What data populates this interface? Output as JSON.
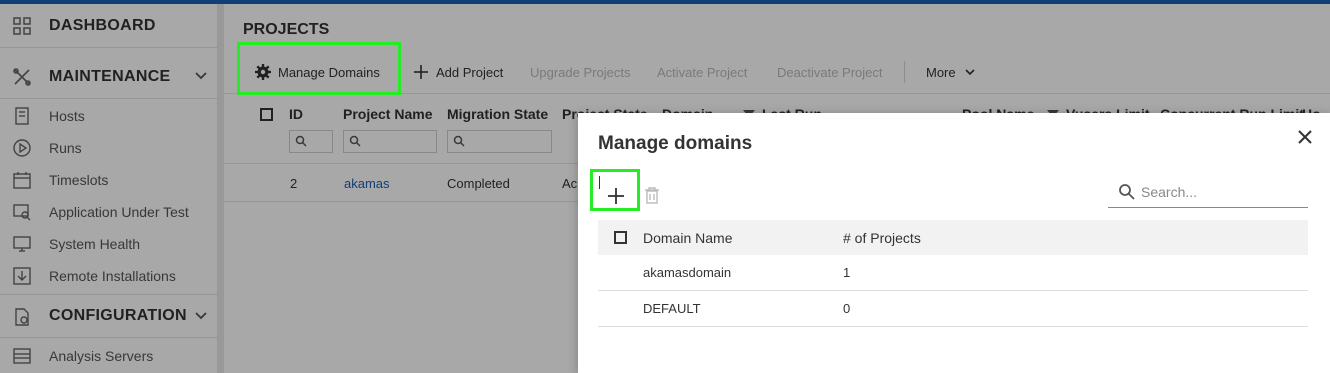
{
  "sidebar": {
    "dashboard": {
      "label": "DASHBOARD",
      "icon": "dashboard-grid-icon"
    },
    "maintenance": {
      "label": "MAINTENANCE",
      "icon": "tools-icon",
      "items": [
        {
          "label": "Hosts",
          "icon": "hosts-icon"
        },
        {
          "label": "Runs",
          "icon": "play-circle-icon"
        },
        {
          "label": "Timeslots",
          "icon": "calendar-icon"
        },
        {
          "label": "Application Under Test",
          "icon": "app-search-icon"
        },
        {
          "label": "System Health",
          "icon": "monitor-icon"
        },
        {
          "label": "Remote Installations",
          "icon": "download-icon"
        }
      ]
    },
    "configuration": {
      "label": "CONFIGURATION",
      "icon": "config-icon",
      "items": [
        {
          "label": "Analysis Servers",
          "icon": "server-list-icon"
        }
      ]
    }
  },
  "main": {
    "title": "PROJECTS",
    "toolbar": {
      "manage_domains": "Manage Domains",
      "add_project": "Add Project",
      "upgrade_projects": "Upgrade Projects",
      "activate_project": "Activate Project",
      "deactivate_project": "Deactivate Project",
      "more": "More"
    },
    "grid": {
      "columns": {
        "id": "ID",
        "project_name": "Project Name",
        "migration_state": "Migration State",
        "project_state": "Project State",
        "domain": "Domain",
        "last_run": "Last Run",
        "pool_name": "Pool Name",
        "vusers_limit": "Vusers Limit",
        "concurrent_run_limit": "Concurrent Run Limit",
        "truncated": "Ho"
      },
      "rows": [
        {
          "id": "2",
          "project_name": "akamas",
          "migration_state": "Completed",
          "project_state": "Ac"
        }
      ]
    }
  },
  "modal": {
    "title": "Manage domains",
    "search_placeholder": "Search...",
    "columns": {
      "domain_name": "Domain Name",
      "projects_count": "# of Projects"
    },
    "rows": [
      {
        "domain_name": "akamasdomain",
        "projects_count": "1"
      },
      {
        "domain_name": "DEFAULT",
        "projects_count": "0"
      }
    ]
  },
  "colors": {
    "accent": "#1a5fb4",
    "highlight": "#22ee22",
    "overlay": "rgba(0,0,0,0.34)"
  }
}
